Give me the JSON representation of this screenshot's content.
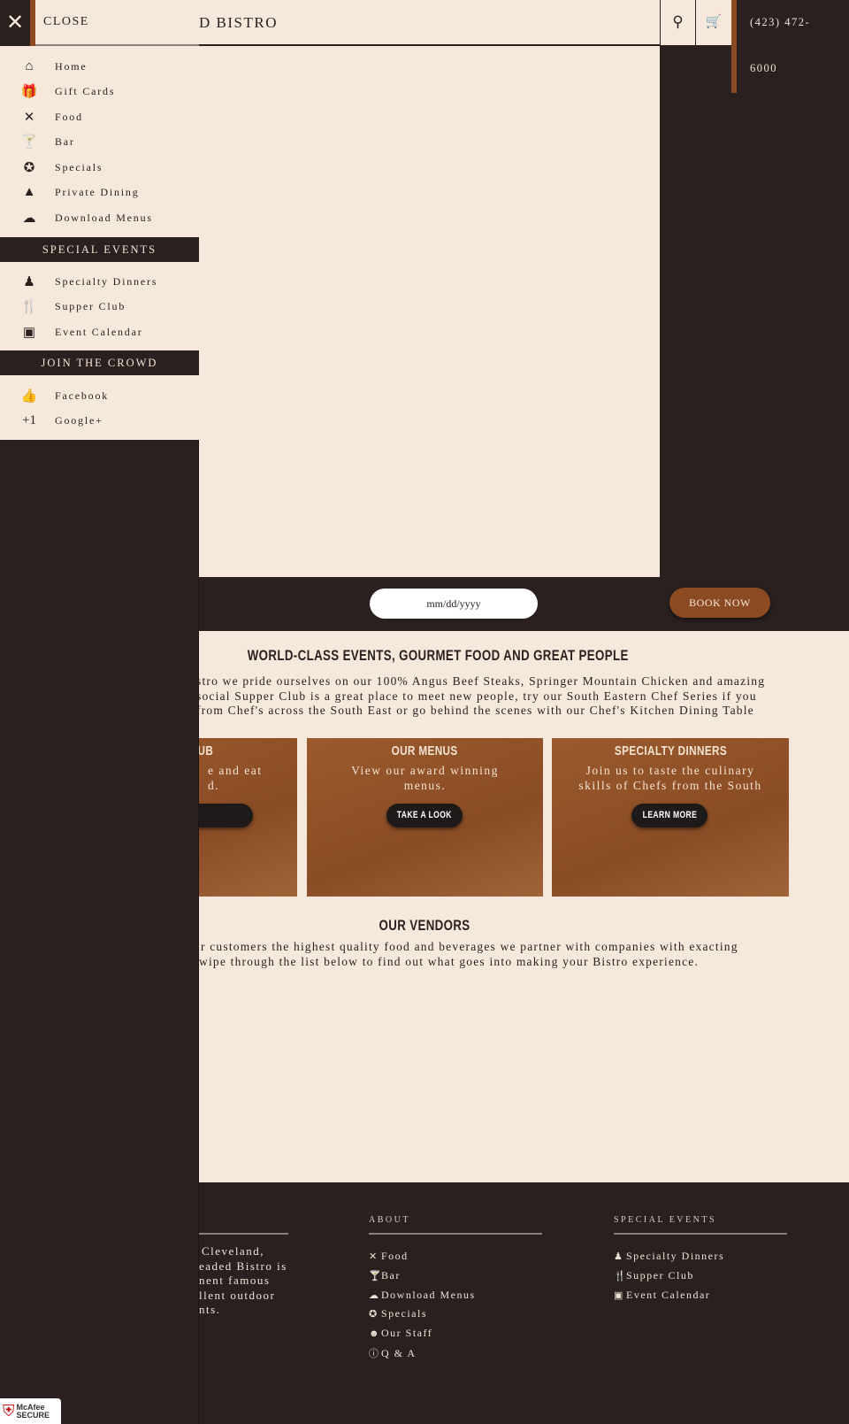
{
  "header": {
    "title": "D BISTRO",
    "search_icon": "search-icon",
    "cart_icon": "cart-icon",
    "phone_line1": "(423) 472-",
    "phone_line2": "6000"
  },
  "booking": {
    "date_placeholder": "mm/dd/yyyy",
    "book_label": "BOOK NOW"
  },
  "intro": {
    "heading": "WORLD-CLASS EVENTS, GOURMET FOOD AND GREAT PEOPLE",
    "lines": [
      "stro we pride ourselves on our 100% Angus Beef Steaks, Springer Mountain Chicken and amazing",
      "social Supper Club is a great place to meet new people, try our South Eastern Chef Series if you",
      "from Chef's across the South East or go behind the scenes with our Chef's Kitchen Dining Table"
    ]
  },
  "cards": [
    {
      "title": "UB",
      "desc1": "e and eat",
      "desc2": "d.",
      "button": ""
    },
    {
      "title": "OUR MENUS",
      "desc1": "View our award winning",
      "desc2": "menus.",
      "button": "TAKE A LOOK"
    },
    {
      "title": "SPECIALTY DINNERS",
      "desc1": "Join us to taste the culinary",
      "desc2": "skills of Chefs from the South",
      "button": "LEARN MORE"
    }
  ],
  "vendors": {
    "heading": "OUR VENDORS",
    "lines": [
      "ır customers the highest quality food and beverages we partner with companies with exacting",
      "wipe through the list below to find out what goes into making your Bistro experience."
    ]
  },
  "footer": {
    "about_lines": [
      "Cleveland,",
      "eaded Bistro is",
      "nent famous",
      "llent outdoor",
      "nts."
    ],
    "about": {
      "title": "ABOUT",
      "items": [
        {
          "icon": "food-icon",
          "label": "Food"
        },
        {
          "icon": "bar-icon",
          "label": "Bar"
        },
        {
          "icon": "cloud-download-icon",
          "label": "Download Menus"
        },
        {
          "icon": "star-icon",
          "label": "Specials"
        },
        {
          "icon": "staff-icon",
          "label": "Our Staff"
        },
        {
          "icon": "info-icon",
          "label": "Q & A"
        }
      ]
    },
    "events": {
      "title": "SPECIAL EVENTS",
      "items": [
        {
          "icon": "people-icon",
          "label": "Specialty Dinners"
        },
        {
          "icon": "utensils-icon",
          "label": "Supper Club"
        },
        {
          "icon": "calendar-icon",
          "label": "Event Calendar"
        }
      ]
    },
    "badge": "McAfee SECURE"
  },
  "sidebar": {
    "close_label": "CLOSE",
    "items": [
      {
        "icon": "home-icon",
        "label": "Home"
      },
      {
        "icon": "gift-card-icon",
        "label": "Gift Cards"
      },
      {
        "icon": "food-icon",
        "label": "Food"
      },
      {
        "icon": "bar-icon",
        "label": "Bar"
      },
      {
        "icon": "star-icon",
        "label": "Specials"
      },
      {
        "icon": "private-dining-icon",
        "label": "Private Dining"
      },
      {
        "icon": "cloud-download-icon",
        "label": "Download Menus"
      }
    ],
    "section1": "SPECIAL EVENTS",
    "events": [
      {
        "icon": "people-icon",
        "label": "Specialty Dinners"
      },
      {
        "icon": "utensils-icon",
        "label": "Supper Club"
      },
      {
        "icon": "calendar-icon",
        "label": "Event Calendar"
      }
    ],
    "section2": "JOIN THE CROWD",
    "social": [
      {
        "icon": "thumbs-up-icon",
        "label": "Facebook"
      },
      {
        "icon": "plus-one-icon",
        "label": "Google+"
      }
    ]
  },
  "colors": {
    "cream": "#f6e9db",
    "dark": "#2a2020",
    "accent": "#8b4a22"
  }
}
